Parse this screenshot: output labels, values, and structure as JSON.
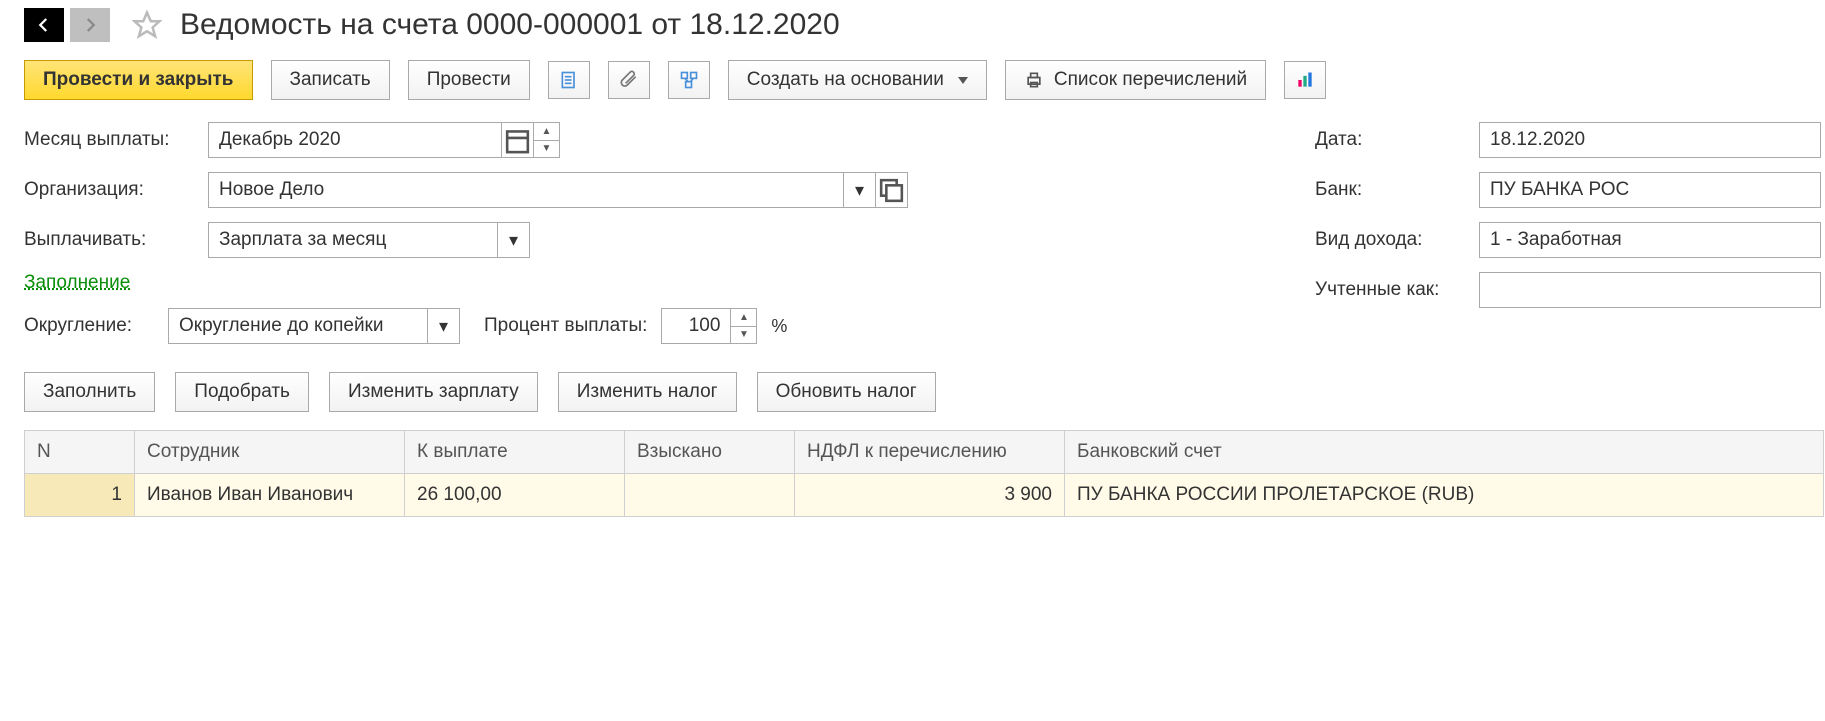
{
  "title": "Ведомость на счета 0000-000001 от 18.12.2020",
  "toolbar": {
    "post_close": "Провести и закрыть",
    "save": "Записать",
    "post": "Провести",
    "create_based": "Создать на основании",
    "transfer_list": "Список перечислений"
  },
  "form": {
    "month_label": "Месяц выплаты:",
    "month_value": "Декабрь 2020",
    "org_label": "Организация:",
    "org_value": "Новое Дело",
    "pay_label": "Выплачивать:",
    "pay_value": "Зарплата за месяц",
    "fill_link": "Заполнение",
    "round_label": "Округление:",
    "round_value": "Округление до копейки",
    "percent_label": "Процент выплаты:",
    "percent_value": "100",
    "percent_sign": "%"
  },
  "right": {
    "date_label": "Дата:",
    "date_value": "18.12.2020",
    "bank_label": "Банк:",
    "bank_value": "ПУ БАНКА РОС",
    "income_label": "Вид дохода:",
    "income_value": "1 - Заработная",
    "accounted_label": "Учтенные как:",
    "accounted_value": ""
  },
  "actions": {
    "fill": "Заполнить",
    "pick": "Подобрать",
    "change_salary": "Изменить зарплату",
    "change_tax": "Изменить налог",
    "update_tax": "Обновить налог"
  },
  "table": {
    "headers": {
      "n": "N",
      "employee": "Сотрудник",
      "to_pay": "К выплате",
      "withheld": "Взыскано",
      "ndfl": "НДФЛ к перечислению",
      "bank_account": "Банковский счет"
    },
    "rows": [
      {
        "n": "1",
        "employee": "Иванов Иван Иванович",
        "to_pay": "26 100,00",
        "withheld": "",
        "ndfl": "3 900",
        "bank_account": "ПУ БАНКА РОССИИ ПРОЛЕТАРСКОЕ (RUB)"
      }
    ]
  }
}
